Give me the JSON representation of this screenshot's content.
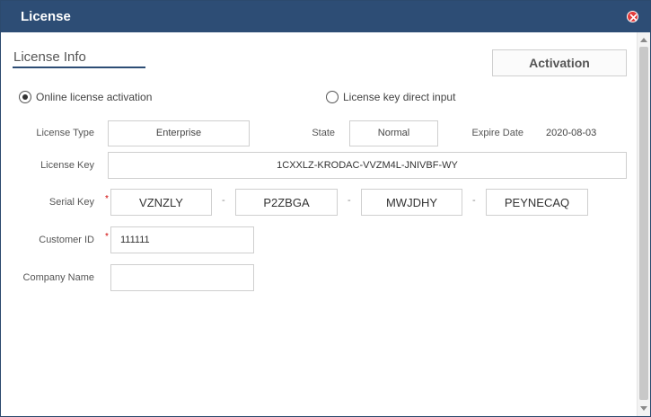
{
  "window": {
    "title": "License"
  },
  "section": {
    "title": "License Info"
  },
  "buttons": {
    "activation": "Activation"
  },
  "radios": [
    {
      "label": "Online license activation",
      "checked": true
    },
    {
      "label": "License key direct input",
      "checked": false
    }
  ],
  "license_type": {
    "label": "License Type",
    "value": "Enterprise"
  },
  "state": {
    "label": "State",
    "value": "Normal"
  },
  "expire_date": {
    "label": "Expire Date",
    "value": "2020-08-03"
  },
  "license_key": {
    "label": "License Key",
    "value": "1CXXLZ-KRODAC-VVZM4L-JNIVBF-WY"
  },
  "serial_key": {
    "label": "Serial Key",
    "required_mark": "*",
    "separator": "-",
    "parts": [
      "VZNZLY",
      "P2ZBGA",
      "MWJDHY",
      "PEYNECAQ"
    ]
  },
  "customer_id": {
    "label": "Customer ID",
    "required_mark": "*",
    "value": "111111"
  },
  "company_name": {
    "label": "Company Name",
    "value": ""
  },
  "colors": {
    "titlebar": "#2d4d75",
    "close": "#e23c3c",
    "required": "#d00000"
  }
}
